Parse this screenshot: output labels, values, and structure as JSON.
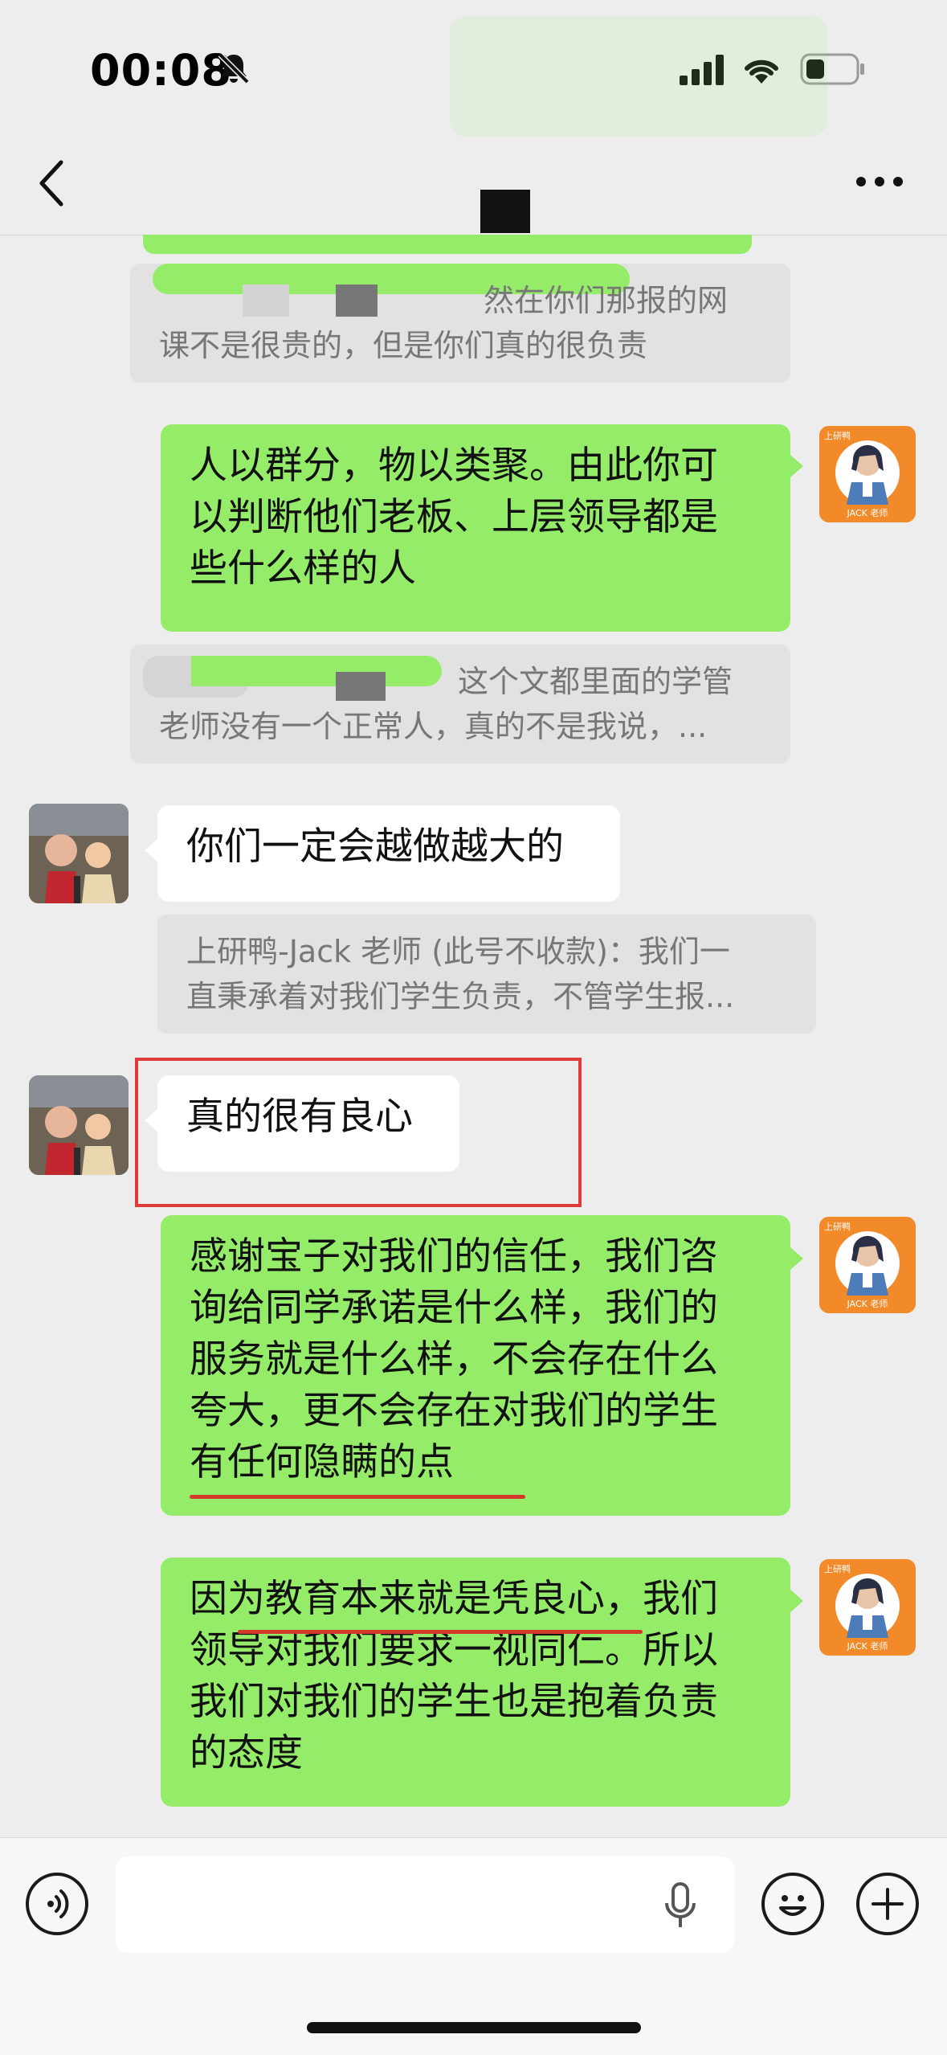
{
  "status_bar": {
    "time": "00:08"
  },
  "messages": [
    {
      "id": "q1",
      "type": "quote",
      "text_line1": "然在你们那报的网",
      "text_line2": "课不是很贵的，但是你们真的很负责"
    },
    {
      "id": "m1",
      "type": "out",
      "lines": [
        "人以群分，物以类聚。由此你可",
        "以判断他们老板、上层领导都是",
        "些什么样的人"
      ]
    },
    {
      "id": "q2",
      "type": "quote",
      "text_line1": "这个文都里面的学管",
      "text_line2": "老师没有一个正常人，真的不是我说，..."
    },
    {
      "id": "m2",
      "type": "in",
      "text": "你们一定会越做越大的"
    },
    {
      "id": "q3",
      "type": "quote",
      "text_line1": "上研鸭-Jack 老师 (此号不收款)：我们一",
      "text_line2": "直秉承着对我们学生负责，不管学生报..."
    },
    {
      "id": "m3",
      "type": "in",
      "text": "真的很有良心"
    },
    {
      "id": "m4",
      "type": "out",
      "lines": [
        "感谢宝子对我们的信任，我们咨",
        "询给同学承诺是什么样，我们的",
        "服务就是什么样，不会存在什么",
        "夸大，更不会存在对我们的学生",
        "有任何隐瞒的点"
      ]
    },
    {
      "id": "m5",
      "type": "out",
      "lines": [
        "因为教育本来就是凭良心，我们",
        "领导对我们要求一视同仁。所以",
        "我们对我们的学生也是抱着负责",
        "的态度"
      ]
    }
  ],
  "avatar_label_me": "JACK 老师",
  "avatar_badge_me": "上研鸭",
  "colors": {
    "bubble_out": "#95ec69",
    "bubble_in": "#ffffff",
    "highlight_box": "#e03a3a",
    "underline": "#d33a2c"
  }
}
